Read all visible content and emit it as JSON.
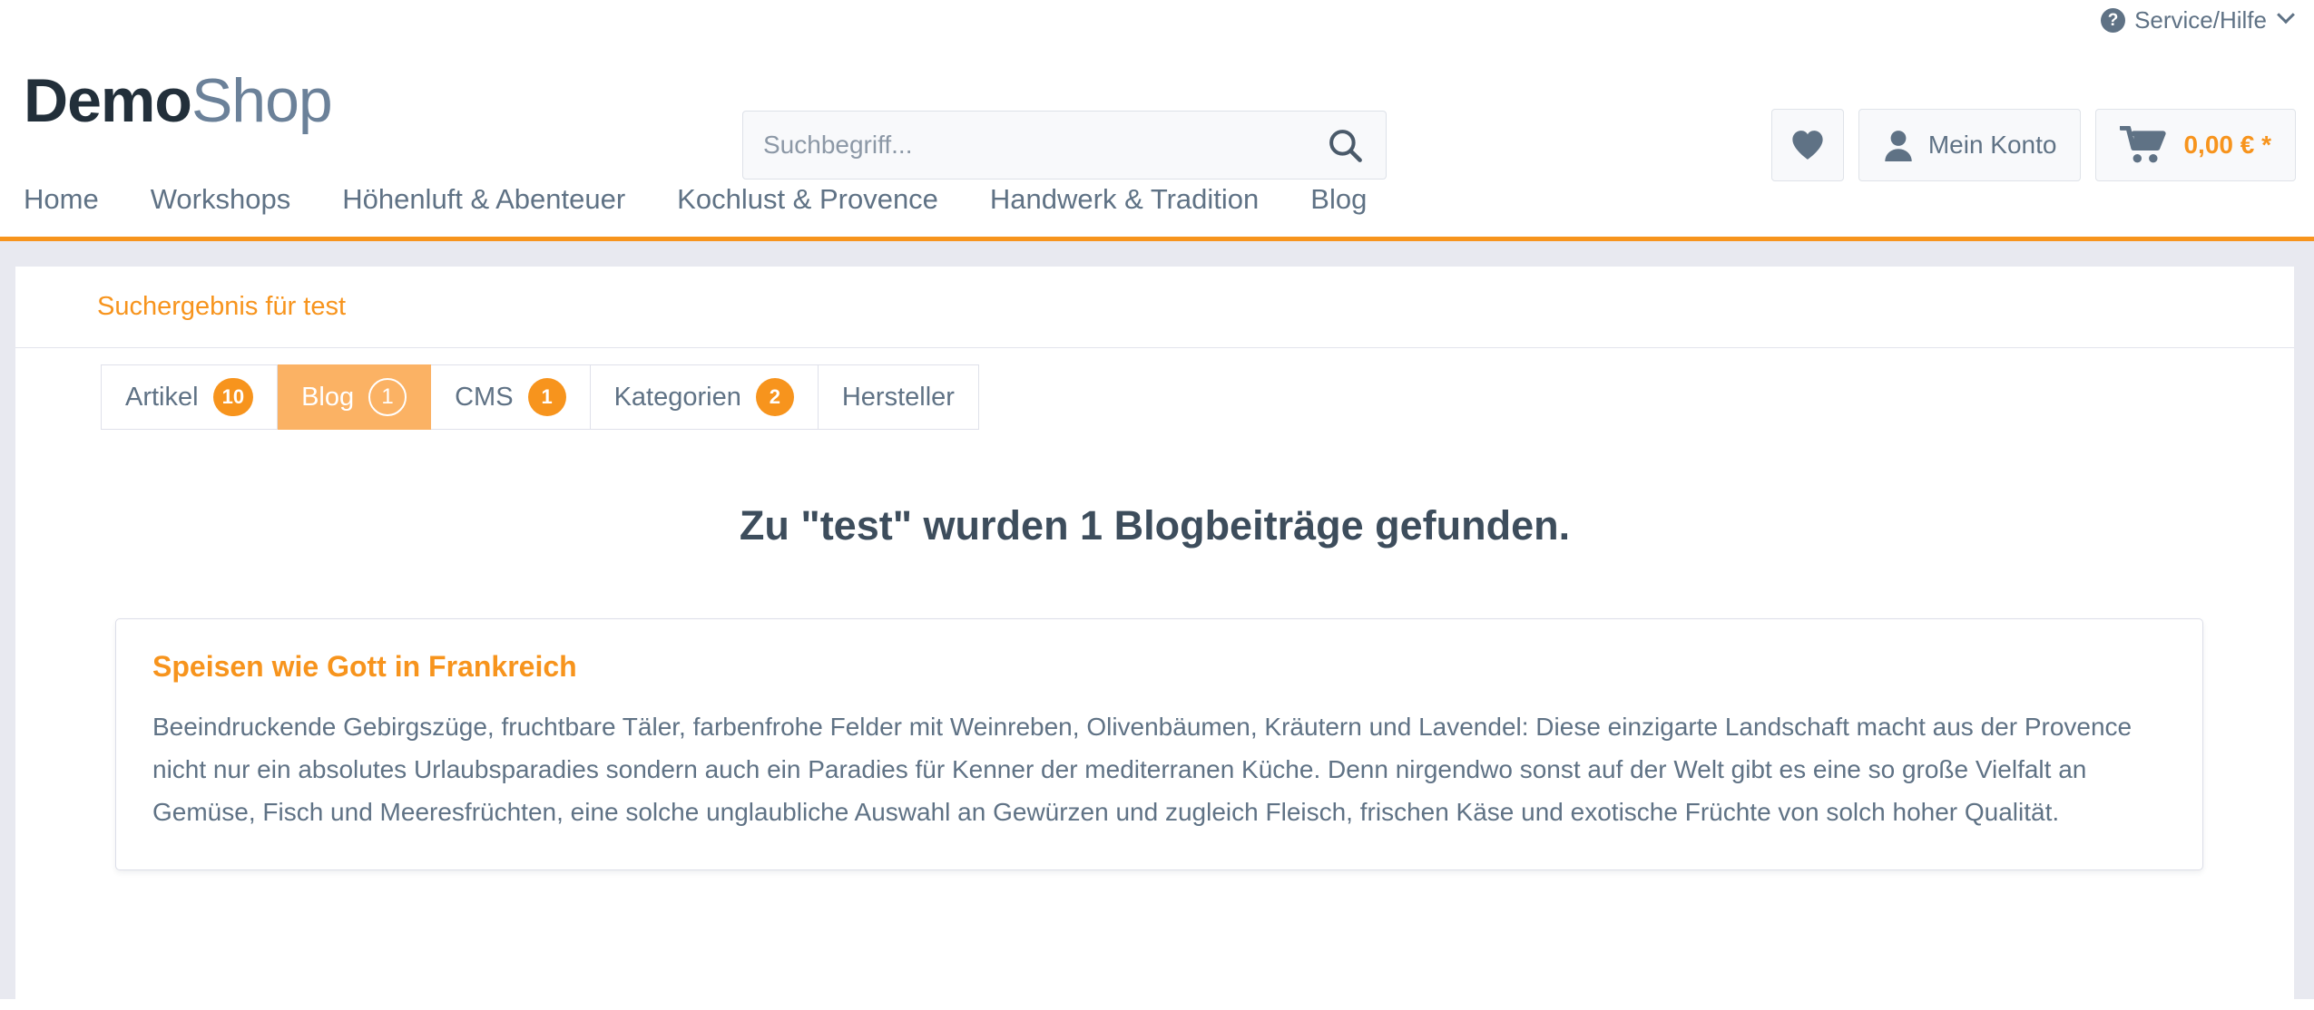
{
  "topbar": {
    "service_label": "Service/Hilfe",
    "help_icon": "question-circle-icon",
    "chevron": "chevron-down-icon"
  },
  "header": {
    "logo_primary": "Demo",
    "logo_secondary": "Shop",
    "search": {
      "placeholder": "Suchbegriff...",
      "value": "",
      "icon": "search-icon"
    },
    "actions": {
      "wishlist_icon": "heart-icon",
      "account_icon": "user-icon",
      "account_label": "Mein Konto",
      "cart_icon": "shopping-cart-icon",
      "cart_amount": "0,00 € *"
    }
  },
  "nav": {
    "items": [
      {
        "label": "Home"
      },
      {
        "label": "Workshops"
      },
      {
        "label": "Höhenluft & Abenteuer"
      },
      {
        "label": "Kochlust & Provence"
      },
      {
        "label": "Handwerk & Tradition"
      },
      {
        "label": "Blog"
      }
    ]
  },
  "breadcrumb": {
    "label": "Suchergebnis für test"
  },
  "tabs": [
    {
      "label": "Artikel",
      "count": "10",
      "active": false
    },
    {
      "label": "Blog",
      "count": "1",
      "active": true
    },
    {
      "label": "CMS",
      "count": "1",
      "active": false
    },
    {
      "label": "Kategorien",
      "count": "2",
      "active": false
    },
    {
      "label": "Hersteller",
      "count": "",
      "active": false
    }
  ],
  "results": {
    "headline": "Zu \"test\" wurden 1 Blogbeiträge gefunden.",
    "items": [
      {
        "title": "Speisen wie Gott in Frankreich",
        "text": "Beeindruckende Gebirgszüge, fruchtbare Täler, farbenfrohe Felder mit Weinreben, Olivenbäumen, Kräutern und Lavendel: Diese einzigarte Landschaft macht aus der Provence nicht nur ein absolutes Urlaubsparadies sondern auch ein Paradies für Kenner der mediterranen Küche. Denn nirgendwo sonst auf der Welt gibt es eine so große Vielfalt an Gemüse, Fisch und Meeresfrüchten, eine solche unglaubliche Auswahl an Gewürzen und zugleich Fleisch, frischen Käse und exotische Früchte von solch hoher Qualität."
      }
    ]
  },
  "colors": {
    "accent_orange": "#f7941d",
    "active_tab_orange": "#fbb264",
    "slate": "#5f7285",
    "dark_slate": "#3d4d5c",
    "page_bg": "#e8e9f0"
  }
}
